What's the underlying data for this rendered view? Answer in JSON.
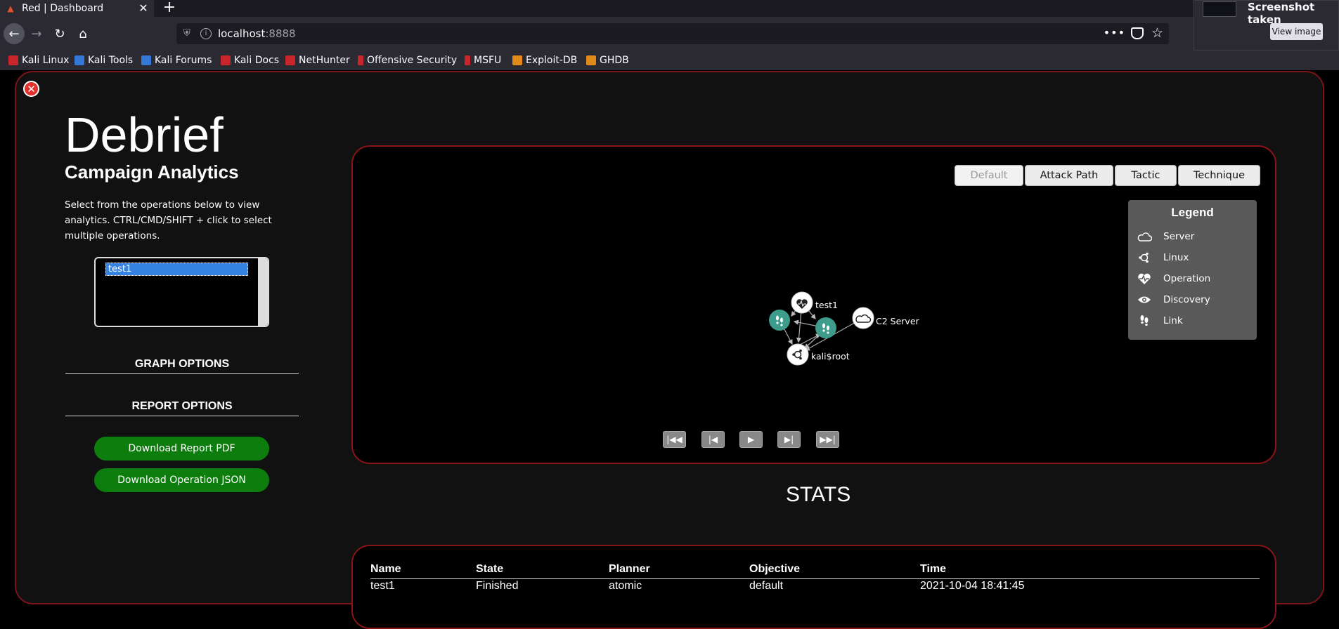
{
  "browser": {
    "tab_title": "Red | Dashboard",
    "url_host": "localhost",
    "url_port": ":8888",
    "bookmarks": [
      "Kali Linux",
      "Kali Tools",
      "Kali Forums",
      "Kali Docs",
      "NetHunter",
      "Offensive Security",
      "MSFU",
      "Exploit-DB",
      "GHDB"
    ],
    "notification": {
      "title": "Screenshot taken",
      "button": "View image"
    }
  },
  "sidebar": {
    "title": "Debrief",
    "subtitle": "Campaign Analytics",
    "description": "Select from the operations below to view analytics. CTRL/CMD/SHIFT + click to select multiple operations.",
    "operations": [
      "test1"
    ],
    "graph_options": "GRAPH OPTIONS",
    "report_options": "REPORT OPTIONS",
    "download_pdf": "Download Report PDF",
    "download_json": "Download Operation JSON"
  },
  "graph": {
    "view_buttons": [
      "Default",
      "Attack Path",
      "Tactic",
      "Technique"
    ],
    "active_view": "Default",
    "legend": {
      "title": "Legend",
      "items": [
        {
          "label": "Server",
          "icon": "cloud-icon"
        },
        {
          "label": "Linux",
          "icon": "linux-icon"
        },
        {
          "label": "Operation",
          "icon": "heartbeat-icon"
        },
        {
          "label": "Discovery",
          "icon": "eye-icon"
        },
        {
          "label": "Link",
          "icon": "footsteps-icon"
        }
      ]
    },
    "nodes": [
      {
        "label": "test1",
        "type": "operation"
      },
      {
        "label": "C2 Server",
        "type": "server"
      },
      {
        "label": "kali$root",
        "type": "linux"
      },
      {
        "label": "",
        "type": "link"
      },
      {
        "label": "",
        "type": "link"
      }
    ],
    "playback": [
      "first-icon",
      "previous-icon",
      "play-icon",
      "next-icon",
      "last-icon"
    ]
  },
  "stats": {
    "title": "STATS",
    "headers": [
      "Name",
      "State",
      "Planner",
      "Objective",
      "Time"
    ],
    "rows": [
      [
        "test1",
        "Finished",
        "atomic",
        "default",
        "2021-10-04 18:41:45"
      ]
    ]
  },
  "colors": {
    "accent": "#8a1418",
    "green": "#0d7d0d",
    "node_teal": "#3d9c8c"
  }
}
